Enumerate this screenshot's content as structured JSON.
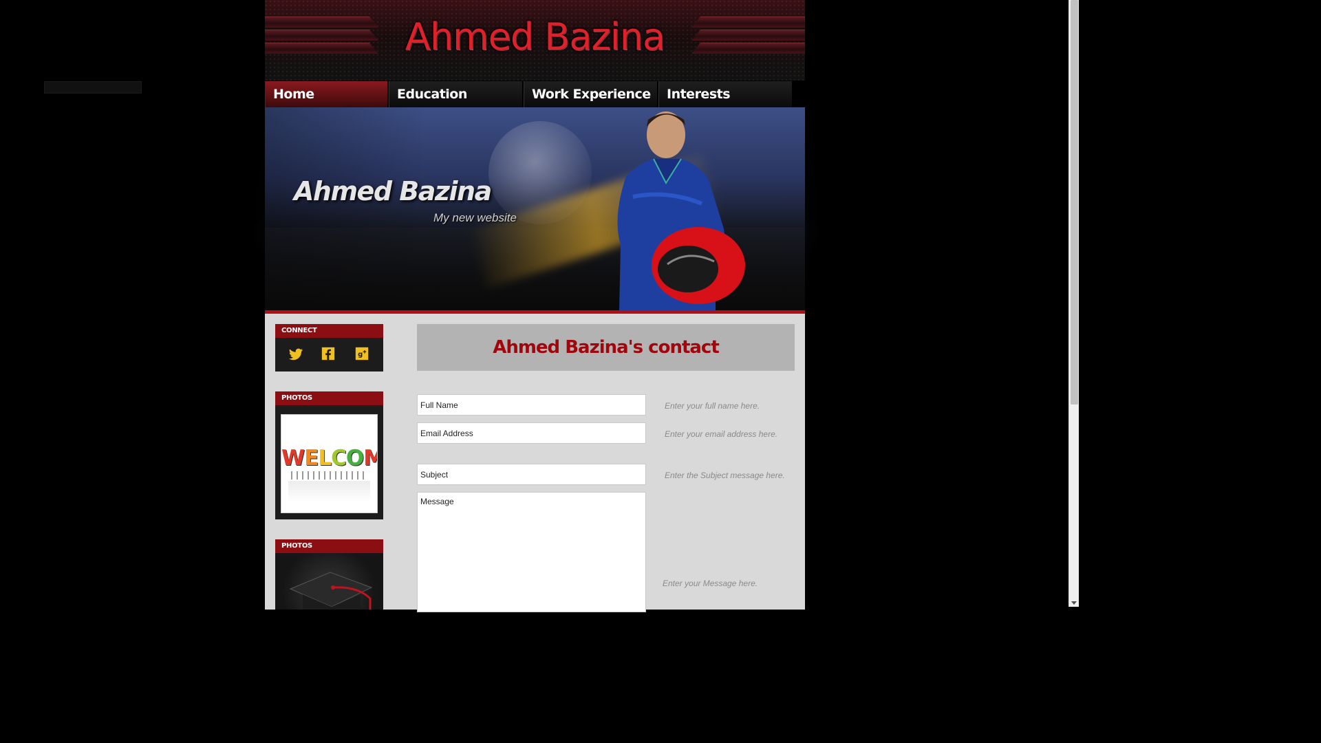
{
  "header": {
    "site_title": "Ahmed Bazina"
  },
  "nav": {
    "items": [
      {
        "label": "Home",
        "active": true
      },
      {
        "label": "Education",
        "active": false
      },
      {
        "label": "Work Experience",
        "active": false
      },
      {
        "label": "Interests",
        "active": false
      }
    ]
  },
  "banner": {
    "title": "Ahmed Bazina",
    "subtitle": "My new website"
  },
  "sidebar": {
    "connect": {
      "heading": "CONNECT",
      "icons": [
        "twitter-icon",
        "facebook-icon",
        "google-plus-icon"
      ]
    },
    "photos_1": {
      "heading": "PHOTOS",
      "image_text": "WELCOME"
    },
    "photos_2": {
      "heading": "PHOTOS"
    }
  },
  "contact": {
    "title": "Ahmed Bazina's contact",
    "fields": {
      "full_name": {
        "placeholder": "Full Name",
        "hint": "Enter your full name here."
      },
      "email": {
        "placeholder": "Email Address",
        "hint": "Enter your email address here."
      },
      "subject": {
        "placeholder": "Subject",
        "hint": "Enter the Subject message here."
      },
      "message": {
        "placeholder": "Message",
        "hint": "Enter your Message here."
      }
    }
  },
  "colors": {
    "accent_red": "#a0060c",
    "nav_active": "#8a1a1e",
    "social_icon": "#f0c020",
    "content_bg": "#d9d9d9"
  }
}
